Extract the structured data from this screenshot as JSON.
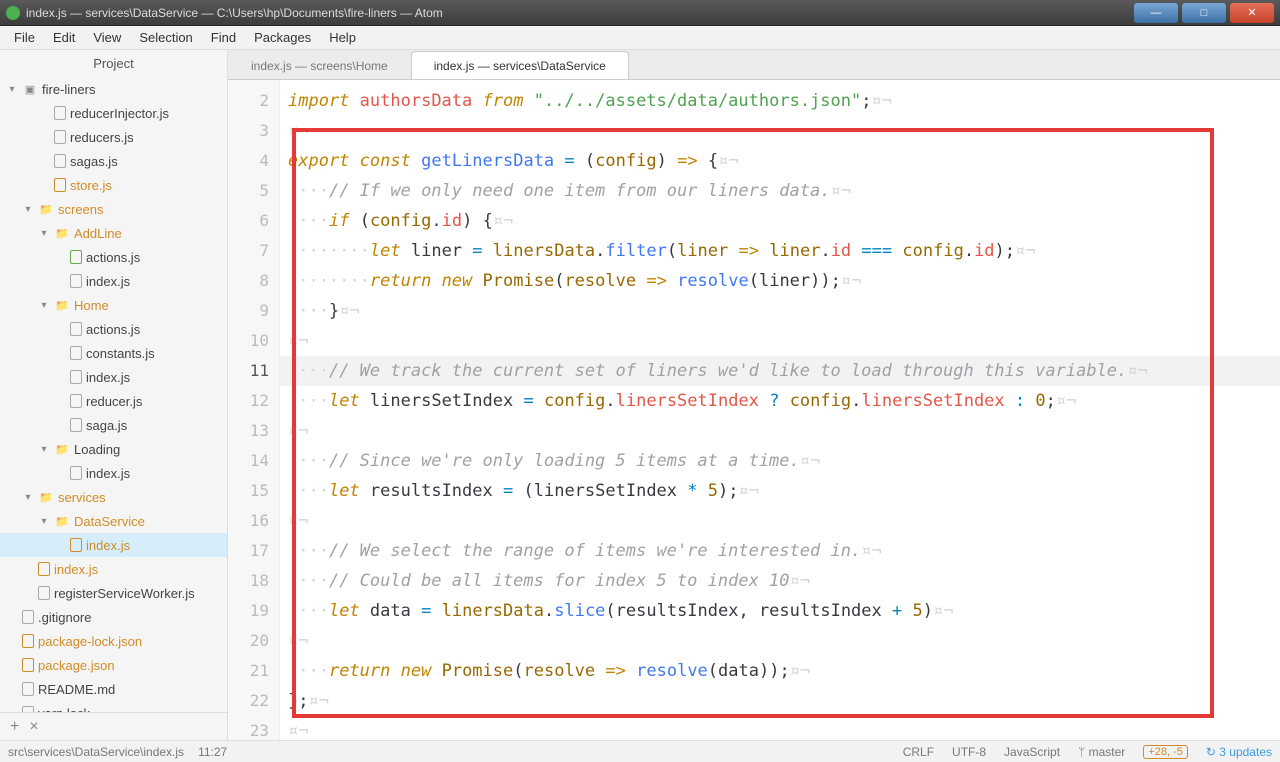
{
  "window": {
    "title": "index.js — services\\DataService — C:\\Users\\hp\\Documents\\fire-liners — Atom",
    "buttons": {
      "min": "—",
      "max": "□",
      "close": "✕"
    }
  },
  "menu": {
    "items": [
      "File",
      "Edit",
      "View",
      "Selection",
      "Find",
      "Packages",
      "Help"
    ]
  },
  "sidebar": {
    "title": "Project",
    "add": "+",
    "close": "×"
  },
  "tree": [
    {
      "d": 0,
      "chev": "▾",
      "icon": "repo",
      "label": "fire-liners"
    },
    {
      "d": 2,
      "chev": "",
      "icon": "file",
      "label": "reducerInjector.js"
    },
    {
      "d": 2,
      "chev": "",
      "icon": "file",
      "label": "reducers.js"
    },
    {
      "d": 2,
      "chev": "",
      "icon": "file",
      "label": "sagas.js"
    },
    {
      "d": 2,
      "chev": "",
      "icon": "file-o",
      "label": "store.js",
      "cls": "active"
    },
    {
      "d": 1,
      "chev": "▾",
      "icon": "folder",
      "label": "screens",
      "cls": "active"
    },
    {
      "d": 2,
      "chev": "▾",
      "icon": "folder",
      "label": "AddLine",
      "cls": "active"
    },
    {
      "d": 3,
      "chev": "",
      "icon": "file-g",
      "label": "actions.js"
    },
    {
      "d": 3,
      "chev": "",
      "icon": "file",
      "label": "index.js"
    },
    {
      "d": 2,
      "chev": "▾",
      "icon": "folder",
      "label": "Home",
      "cls": "active"
    },
    {
      "d": 3,
      "chev": "",
      "icon": "file",
      "label": "actions.js"
    },
    {
      "d": 3,
      "chev": "",
      "icon": "file",
      "label": "constants.js"
    },
    {
      "d": 3,
      "chev": "",
      "icon": "file",
      "label": "index.js"
    },
    {
      "d": 3,
      "chev": "",
      "icon": "file",
      "label": "reducer.js"
    },
    {
      "d": 3,
      "chev": "",
      "icon": "file",
      "label": "saga.js"
    },
    {
      "d": 2,
      "chev": "▾",
      "icon": "folder-dark",
      "label": "Loading"
    },
    {
      "d": 3,
      "chev": "",
      "icon": "file",
      "label": "index.js"
    },
    {
      "d": 1,
      "chev": "▾",
      "icon": "folder",
      "label": "services",
      "cls": "active"
    },
    {
      "d": 2,
      "chev": "▾",
      "icon": "folder",
      "label": "DataService",
      "cls": "active"
    },
    {
      "d": 3,
      "chev": "",
      "icon": "file-o",
      "label": "index.js",
      "cls": "active sel"
    },
    {
      "d": 1,
      "chev": "",
      "icon": "file-o",
      "label": "index.js",
      "cls": "active"
    },
    {
      "d": 1,
      "chev": "",
      "icon": "file",
      "label": "registerServiceWorker.js"
    },
    {
      "d": 0,
      "chev": "",
      "icon": "file",
      "label": ".gitignore"
    },
    {
      "d": 0,
      "chev": "",
      "icon": "file-o",
      "label": "package-lock.json",
      "cls": "active"
    },
    {
      "d": 0,
      "chev": "",
      "icon": "file-o",
      "label": "package.json",
      "cls": "active"
    },
    {
      "d": 0,
      "chev": "",
      "icon": "file",
      "label": "README.md"
    },
    {
      "d": 0,
      "chev": "",
      "icon": "file",
      "label": "yarn.lock"
    }
  ],
  "tabs": [
    {
      "label": "index.js — screens\\Home",
      "active": false
    },
    {
      "label": "index.js — services\\DataService",
      "active": true
    }
  ],
  "gutter_start": 2,
  "gutter_end": 23,
  "code_lines": [
    {
      "hl": false,
      "html": "<span class='tok-kw'>import</span> <span class='tok-prop'>authorsData</span> <span class='tok-kw'>from</span> <span class='tok-str'>\"../../assets/data/authors.json\"</span><span class='tok-pl'>;</span><span class='invis'>¤¬</span>"
    },
    {
      "hl": false,
      "html": "<span class='invis'>¤¬</span>"
    },
    {
      "hl": false,
      "html": "<span class='tok-kw'>export</span> <span class='tok-kw2'>const</span> <span class='tok-fn'>getLinersData</span> <span class='tok-op'>=</span> <span class='tok-pl'>(</span><span class='tok-var'>config</span><span class='tok-pl'>)</span> <span class='tok-kw2'>=&gt;</span> <span class='tok-pl'>{</span><span class='invis'>¤¬</span>"
    },
    {
      "hl": false,
      "html": "<span class='invis'>····</span><span class='tok-com'>// If we only need one item from our liners data.</span><span class='invis'>¤¬</span>"
    },
    {
      "hl": false,
      "html": "<span class='invis'>····</span><span class='tok-kw'>if</span> <span class='tok-pl'>(</span><span class='tok-var'>config</span><span class='tok-pl'>.</span><span class='tok-prop'>id</span><span class='tok-pl'>) {</span><span class='invis'>¤¬</span>"
    },
    {
      "hl": false,
      "html": "<span class='invis'>········</span><span class='tok-kw2'>let</span> <span class='tok-pl'>liner</span> <span class='tok-op'>=</span> <span class='tok-var'>linersData</span><span class='tok-pl'>.</span><span class='tok-fn'>filter</span><span class='tok-pl'>(</span><span class='tok-var'>liner</span> <span class='tok-kw2'>=&gt;</span> <span class='tok-var'>liner</span><span class='tok-pl'>.</span><span class='tok-prop'>id</span> <span class='tok-op'>===</span> <span class='tok-var'>config</span><span class='tok-pl'>.</span><span class='tok-prop'>id</span><span class='tok-pl'>);</span><span class='invis'>¤¬</span>"
    },
    {
      "hl": false,
      "html": "<span class='invis'>········</span><span class='tok-kw'>return</span> <span class='tok-kw'>new</span> <span class='tok-var'>Promise</span><span class='tok-pl'>(</span><span class='tok-var'>resolve</span> <span class='tok-kw2'>=&gt;</span> <span class='tok-fn'>resolve</span><span class='tok-pl'>(liner));</span><span class='invis'>¤¬</span>"
    },
    {
      "hl": false,
      "html": "<span class='invis'>····</span><span class='tok-pl'>}</span><span class='invis'>¤¬</span>"
    },
    {
      "hl": false,
      "html": "<span class='invis'>¤¬</span>"
    },
    {
      "hl": true,
      "html": "<span class='invis'>····</span><span class='tok-com'>// We track the current set of liners we'd like to load through this variable.</span><span class='invis'>¤¬</span>"
    },
    {
      "hl": false,
      "html": "<span class='invis'>····</span><span class='tok-kw2'>let</span> <span class='tok-pl'>linersSetIndex</span> <span class='tok-op'>=</span> <span class='tok-var'>config</span><span class='tok-pl'>.</span><span class='tok-prop'>linersSetIndex</span> <span class='tok-op'>?</span> <span class='tok-var'>config</span><span class='tok-pl'>.</span><span class='tok-prop'>linersSetIndex</span> <span class='tok-op'>:</span> <span class='tok-num'>0</span><span class='tok-pl'>;</span><span class='invis'>¤¬</span>"
    },
    {
      "hl": false,
      "html": "<span class='invis'>¤¬</span>"
    },
    {
      "hl": false,
      "html": "<span class='invis'>····</span><span class='tok-com'>// Since we're only loading 5 items at a time.</span><span class='invis'>¤¬</span>"
    },
    {
      "hl": false,
      "html": "<span class='invis'>····</span><span class='tok-kw2'>let</span> <span class='tok-pl'>resultsIndex</span> <span class='tok-op'>=</span> <span class='tok-pl'>(linersSetIndex</span> <span class='tok-op'>*</span> <span class='tok-num'>5</span><span class='tok-pl'>);</span><span class='invis'>¤¬</span>"
    },
    {
      "hl": false,
      "html": "<span class='invis'>¤¬</span>"
    },
    {
      "hl": false,
      "html": "<span class='invis'>····</span><span class='tok-com'>// We select the range of items we're interested in.</span><span class='invis'>¤¬</span>"
    },
    {
      "hl": false,
      "html": "<span class='invis'>····</span><span class='tok-com'>// Could be all items for index 5 to index 10</span><span class='invis'>¤¬</span>"
    },
    {
      "hl": false,
      "html": "<span class='invis'>····</span><span class='tok-kw2'>let</span> <span class='tok-pl'>data</span> <span class='tok-op'>=</span> <span class='tok-var'>linersData</span><span class='tok-pl'>.</span><span class='tok-fn'>slice</span><span class='tok-pl'>(resultsIndex, resultsIndex</span> <span class='tok-op'>+</span> <span class='tok-num'>5</span><span class='tok-pl'>)</span><span class='invis'>¤¬</span>"
    },
    {
      "hl": false,
      "html": "<span class='invis'>¤¬</span>"
    },
    {
      "hl": false,
      "html": "<span class='invis'>····</span><span class='tok-kw'>return</span> <span class='tok-kw'>new</span> <span class='tok-var'>Promise</span><span class='tok-pl'>(</span><span class='tok-var'>resolve</span> <span class='tok-kw2'>=&gt;</span> <span class='tok-fn'>resolve</span><span class='tok-pl'>(data));</span><span class='invis'>¤¬</span>"
    },
    {
      "hl": false,
      "html": "<span class='tok-pl'>};</span><span class='invis'>¤¬</span>"
    },
    {
      "hl": false,
      "html": "<span class='invis'>¤¬</span>"
    }
  ],
  "status": {
    "path": "src\\services\\DataService\\index.js",
    "cursor": "11:27",
    "eol": "CRLF",
    "encoding": "UTF-8",
    "lang": "JavaScript",
    "branch_icon": "ᛘ",
    "branch": "master",
    "diff": "+28, -5",
    "updates_icon": "↻",
    "updates": "3 updates"
  }
}
